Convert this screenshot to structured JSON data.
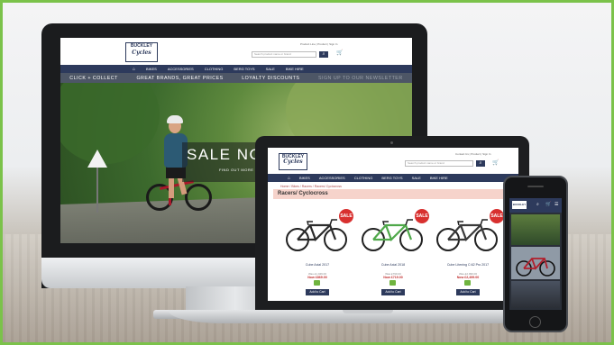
{
  "brand": {
    "line1": "BUCKLEY",
    "line2": "Cycles",
    "accent_color": "#2d3a5c",
    "sale_color": "#d8302f",
    "border_color": "#7bc24a"
  },
  "header": {
    "account_links": "Product Line  | Product  | Sign In",
    "search_placeholder": "Search product name or brand",
    "contact_links": "Contact Us  |  Product  |  Sign In"
  },
  "nav": {
    "home_icon": "home-icon",
    "items": [
      "BIKES",
      "ACCESSORIES",
      "CLOTHING",
      "BERG TOYS",
      "SALE",
      "BIKE HIRE"
    ]
  },
  "promo_bar": {
    "items": [
      "CLICK + COLLECT",
      "GREAT BRANDS, GREAT PRICES",
      "LOYALTY DISCOUNTS",
      "SIGN UP TO OUR NEWSLETTER"
    ]
  },
  "hero": {
    "headline": "SALE NOW",
    "cta": "FIND OUT MORE"
  },
  "category": {
    "breadcrumb": "Home / Bikes / Racers / Racers/ Cyclocross",
    "title": "Racers/ Cyclocross"
  },
  "products": [
    {
      "badge": "SALE",
      "name": "Cube Axial 2017",
      "was": "Was £1,049.00",
      "now": "Now £869.00",
      "add": "Add to Cart",
      "frame_color": "#2b2b2b"
    },
    {
      "badge": "SALE",
      "name": "Cube Axial 2018",
      "was": "Was £799.00",
      "now": "Now £719.00",
      "add": "Add to Cart",
      "frame_color": "#4fa84a"
    },
    {
      "badge": "SALE",
      "name": "Cube Litening C:62 Pro 2017",
      "was": "Was £2,999.00",
      "now": "Now £2,499.00",
      "add": "Add to Cart",
      "frame_color": "#3a3a3a"
    }
  ]
}
